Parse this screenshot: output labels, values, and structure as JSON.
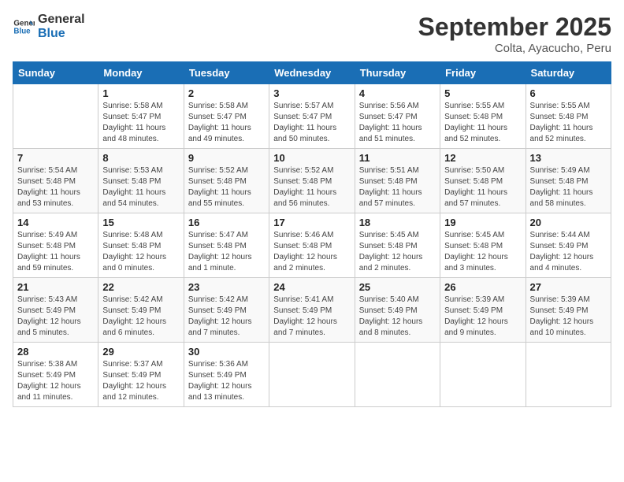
{
  "header": {
    "logo_line1": "General",
    "logo_line2": "Blue",
    "month": "September 2025",
    "location": "Colta, Ayacucho, Peru"
  },
  "days_of_week": [
    "Sunday",
    "Monday",
    "Tuesday",
    "Wednesday",
    "Thursday",
    "Friday",
    "Saturday"
  ],
  "weeks": [
    [
      {
        "num": "",
        "info": ""
      },
      {
        "num": "1",
        "info": "Sunrise: 5:58 AM\nSunset: 5:47 PM\nDaylight: 11 hours\nand 48 minutes."
      },
      {
        "num": "2",
        "info": "Sunrise: 5:58 AM\nSunset: 5:47 PM\nDaylight: 11 hours\nand 49 minutes."
      },
      {
        "num": "3",
        "info": "Sunrise: 5:57 AM\nSunset: 5:47 PM\nDaylight: 11 hours\nand 50 minutes."
      },
      {
        "num": "4",
        "info": "Sunrise: 5:56 AM\nSunset: 5:47 PM\nDaylight: 11 hours\nand 51 minutes."
      },
      {
        "num": "5",
        "info": "Sunrise: 5:55 AM\nSunset: 5:48 PM\nDaylight: 11 hours\nand 52 minutes."
      },
      {
        "num": "6",
        "info": "Sunrise: 5:55 AM\nSunset: 5:48 PM\nDaylight: 11 hours\nand 52 minutes."
      }
    ],
    [
      {
        "num": "7",
        "info": "Sunrise: 5:54 AM\nSunset: 5:48 PM\nDaylight: 11 hours\nand 53 minutes."
      },
      {
        "num": "8",
        "info": "Sunrise: 5:53 AM\nSunset: 5:48 PM\nDaylight: 11 hours\nand 54 minutes."
      },
      {
        "num": "9",
        "info": "Sunrise: 5:52 AM\nSunset: 5:48 PM\nDaylight: 11 hours\nand 55 minutes."
      },
      {
        "num": "10",
        "info": "Sunrise: 5:52 AM\nSunset: 5:48 PM\nDaylight: 11 hours\nand 56 minutes."
      },
      {
        "num": "11",
        "info": "Sunrise: 5:51 AM\nSunset: 5:48 PM\nDaylight: 11 hours\nand 57 minutes."
      },
      {
        "num": "12",
        "info": "Sunrise: 5:50 AM\nSunset: 5:48 PM\nDaylight: 11 hours\nand 57 minutes."
      },
      {
        "num": "13",
        "info": "Sunrise: 5:49 AM\nSunset: 5:48 PM\nDaylight: 11 hours\nand 58 minutes."
      }
    ],
    [
      {
        "num": "14",
        "info": "Sunrise: 5:49 AM\nSunset: 5:48 PM\nDaylight: 11 hours\nand 59 minutes."
      },
      {
        "num": "15",
        "info": "Sunrise: 5:48 AM\nSunset: 5:48 PM\nDaylight: 12 hours\nand 0 minutes."
      },
      {
        "num": "16",
        "info": "Sunrise: 5:47 AM\nSunset: 5:48 PM\nDaylight: 12 hours\nand 1 minute."
      },
      {
        "num": "17",
        "info": "Sunrise: 5:46 AM\nSunset: 5:48 PM\nDaylight: 12 hours\nand 2 minutes."
      },
      {
        "num": "18",
        "info": "Sunrise: 5:45 AM\nSunset: 5:48 PM\nDaylight: 12 hours\nand 2 minutes."
      },
      {
        "num": "19",
        "info": "Sunrise: 5:45 AM\nSunset: 5:48 PM\nDaylight: 12 hours\nand 3 minutes."
      },
      {
        "num": "20",
        "info": "Sunrise: 5:44 AM\nSunset: 5:49 PM\nDaylight: 12 hours\nand 4 minutes."
      }
    ],
    [
      {
        "num": "21",
        "info": "Sunrise: 5:43 AM\nSunset: 5:49 PM\nDaylight: 12 hours\nand 5 minutes."
      },
      {
        "num": "22",
        "info": "Sunrise: 5:42 AM\nSunset: 5:49 PM\nDaylight: 12 hours\nand 6 minutes."
      },
      {
        "num": "23",
        "info": "Sunrise: 5:42 AM\nSunset: 5:49 PM\nDaylight: 12 hours\nand 7 minutes."
      },
      {
        "num": "24",
        "info": "Sunrise: 5:41 AM\nSunset: 5:49 PM\nDaylight: 12 hours\nand 7 minutes."
      },
      {
        "num": "25",
        "info": "Sunrise: 5:40 AM\nSunset: 5:49 PM\nDaylight: 12 hours\nand 8 minutes."
      },
      {
        "num": "26",
        "info": "Sunrise: 5:39 AM\nSunset: 5:49 PM\nDaylight: 12 hours\nand 9 minutes."
      },
      {
        "num": "27",
        "info": "Sunrise: 5:39 AM\nSunset: 5:49 PM\nDaylight: 12 hours\nand 10 minutes."
      }
    ],
    [
      {
        "num": "28",
        "info": "Sunrise: 5:38 AM\nSunset: 5:49 PM\nDaylight: 12 hours\nand 11 minutes."
      },
      {
        "num": "29",
        "info": "Sunrise: 5:37 AM\nSunset: 5:49 PM\nDaylight: 12 hours\nand 12 minutes."
      },
      {
        "num": "30",
        "info": "Sunrise: 5:36 AM\nSunset: 5:49 PM\nDaylight: 12 hours\nand 13 minutes."
      },
      {
        "num": "",
        "info": ""
      },
      {
        "num": "",
        "info": ""
      },
      {
        "num": "",
        "info": ""
      },
      {
        "num": "",
        "info": ""
      }
    ]
  ]
}
